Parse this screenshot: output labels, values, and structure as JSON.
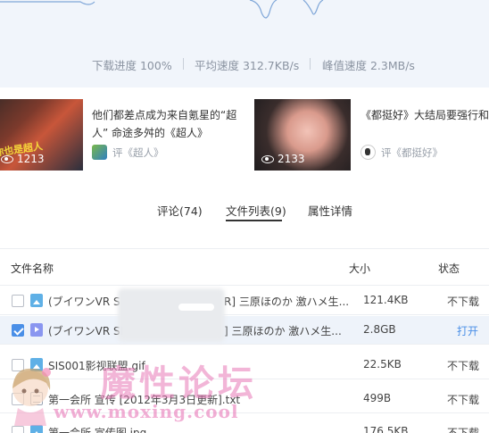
{
  "download_stats": {
    "progress": "下载进度 100%",
    "avg_speed": "平均速度 312.7KB/s",
    "peak_speed": "峰值速度 2.3MB/s"
  },
  "recommendations": [
    {
      "thumb_text": "你也是超人",
      "views": "1213",
      "title": "他们都差点成为来自氪星的“超人”  命途多舛的《超人》",
      "comment": "评《超人》"
    },
    {
      "views": "2133",
      "title": "《都挺好》大结局要强行和解？苏明玉们，请“自私”一点",
      "comment": "评《都挺好》"
    }
  ],
  "tabs": [
    {
      "label": "评论(74)",
      "active": false
    },
    {
      "label": "文件列表(9)",
      "active": true
    },
    {
      "label": "属性详情",
      "active": false
    }
  ],
  "file_list": {
    "headers": {
      "name": "文件名称",
      "size": "大小",
      "status": "状态"
    },
    "rows": [
      {
        "checked": false,
        "icon": "image-file-icon",
        "name": "(ブイワンVR S",
        "name_tail": "R] 三原ほのか 激ハメ生...",
        "size": "121.4KB",
        "status": "不下载"
      },
      {
        "checked": true,
        "icon": "video-file-icon",
        "name": "(ブイワンVR SE",
        "name_tail": "] 三原ほのか 激ハメ生...",
        "size": "2.8GB",
        "status": "打开"
      },
      {
        "checked": false,
        "icon": "image-file-icon",
        "name": "SIS001影视联盟.gif",
        "name_tail": "",
        "size": "22.5KB",
        "status": "不下载"
      },
      {
        "checked": false,
        "icon": "text-file-icon",
        "name": "第一会所 宣传 [2012年3月3日更新].txt",
        "name_tail": "",
        "size": "499B",
        "status": "不下载"
      },
      {
        "checked": false,
        "icon": "image-file-icon",
        "name": "第一会所 宣传图.jpg",
        "name_tail": "",
        "size": "176.5KB",
        "status": "不下载"
      }
    ]
  },
  "watermark": {
    "title": "魔性论坛",
    "url": "www.moxing.cool"
  },
  "colors": {
    "accent": "#4a8fe7",
    "speed_line": "#7fa6d8",
    "watermark": "#e879b8"
  }
}
